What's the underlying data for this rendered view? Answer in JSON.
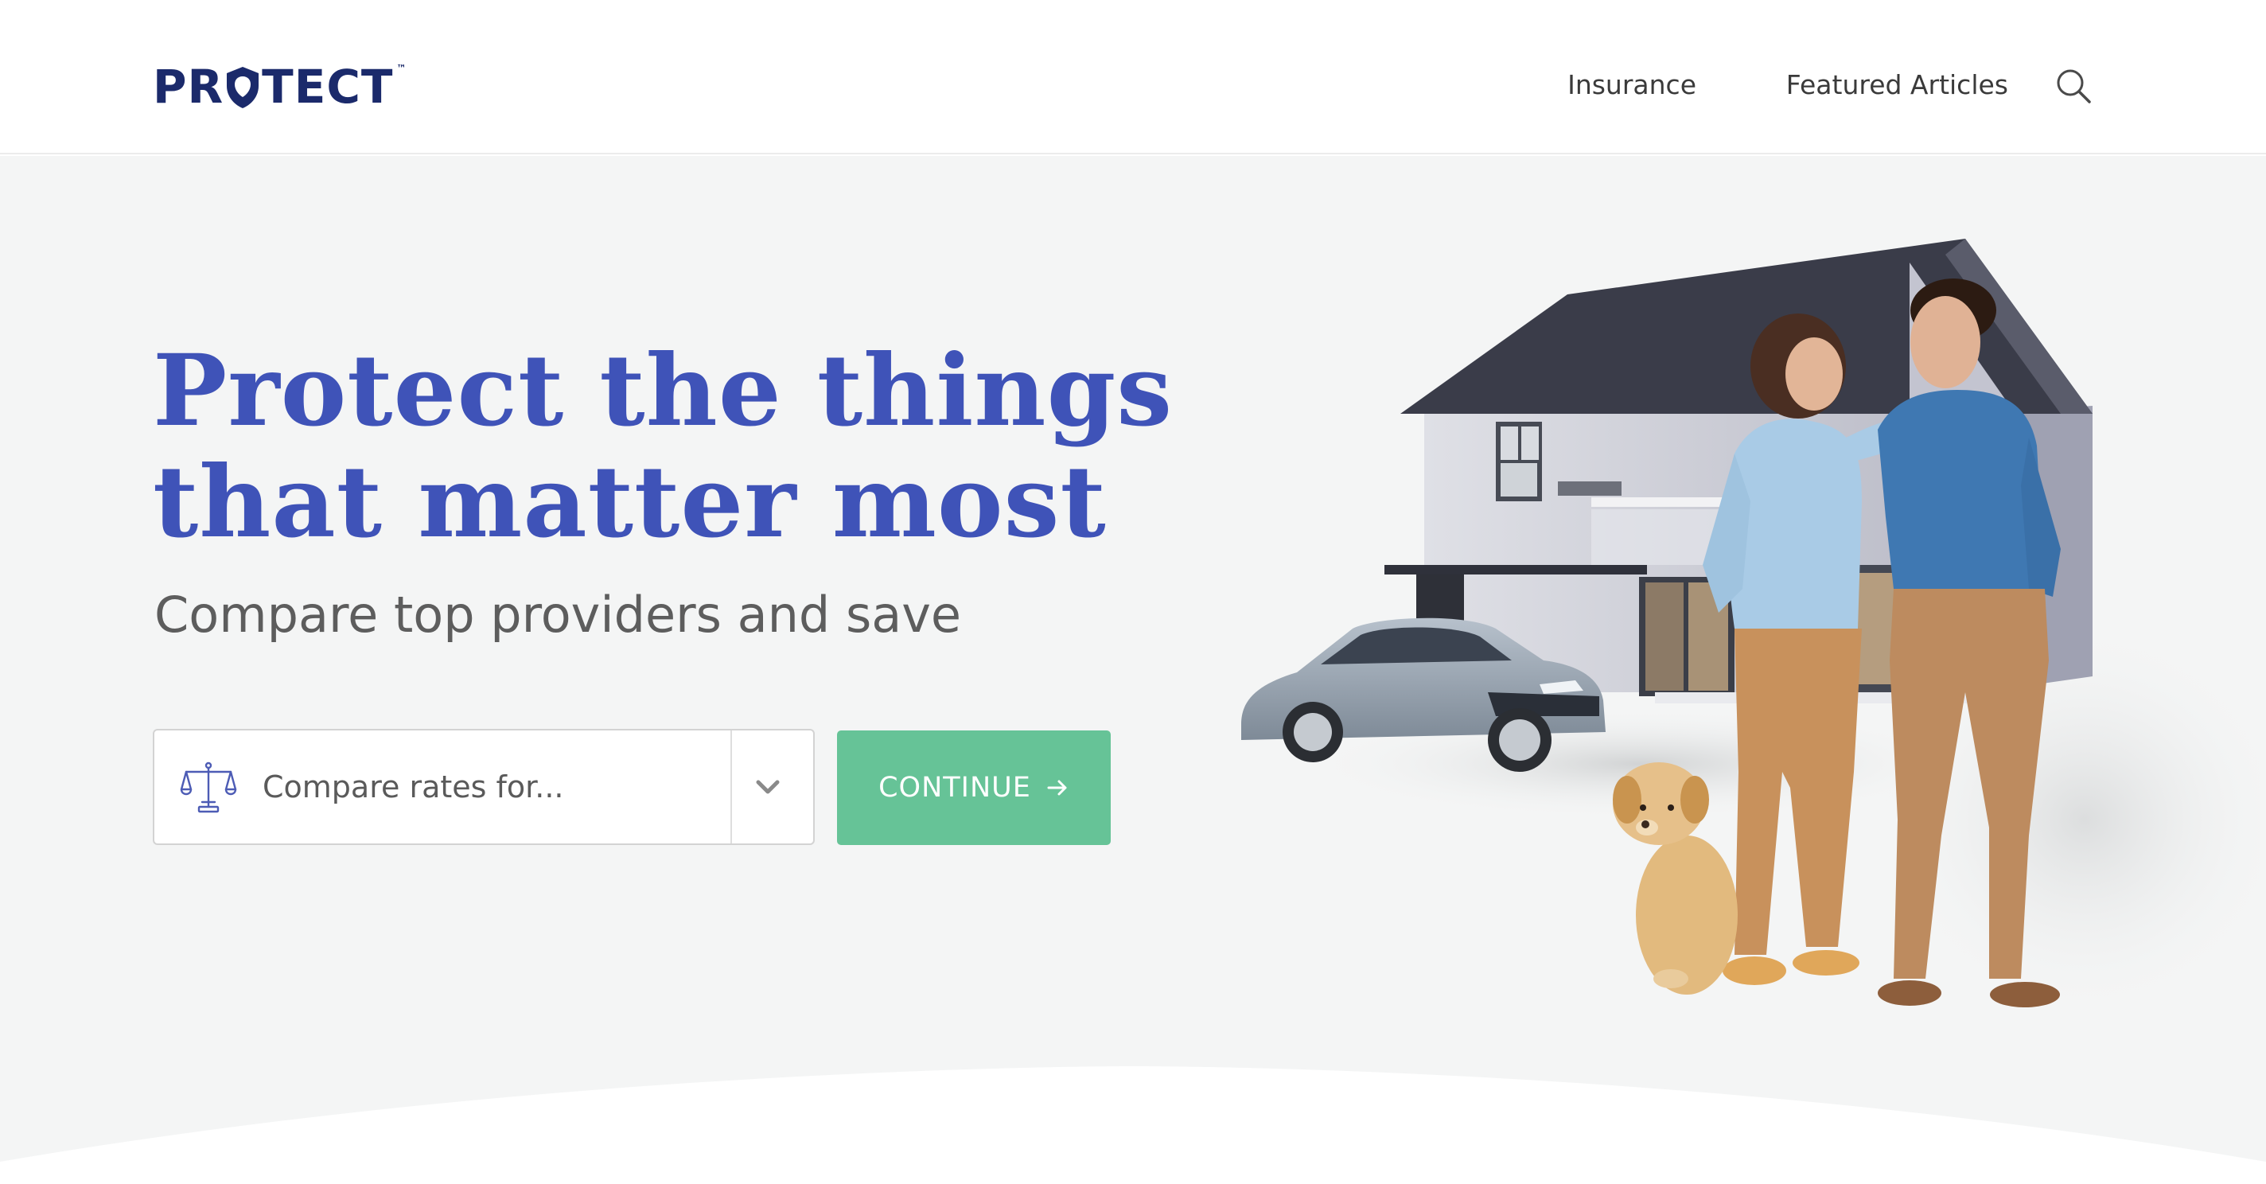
{
  "header": {
    "logo_text_left": "PR",
    "logo_text_right": "TECT",
    "logo_tm": "™",
    "nav": [
      {
        "label": "Insurance"
      },
      {
        "label": "Featured Articles"
      }
    ],
    "search_icon": "search-icon"
  },
  "hero": {
    "headline_line1": "Protect the things",
    "headline_line2": "that matter most",
    "subheadline": "Compare top providers and save",
    "compare_select": {
      "placeholder": "Compare rates for...",
      "icon": "scale-icon",
      "dropdown_icon": "chevron-down-icon"
    },
    "continue_label": "CONTINUE",
    "continue_icon": "arrow-right-icon",
    "illustration": "house-car-couple-dog-image"
  },
  "colors": {
    "brand_navy": "#1b2a6b",
    "headline_blue": "#3f53b8",
    "cta_green": "#66c397",
    "hero_bg": "#f4f5f5"
  }
}
